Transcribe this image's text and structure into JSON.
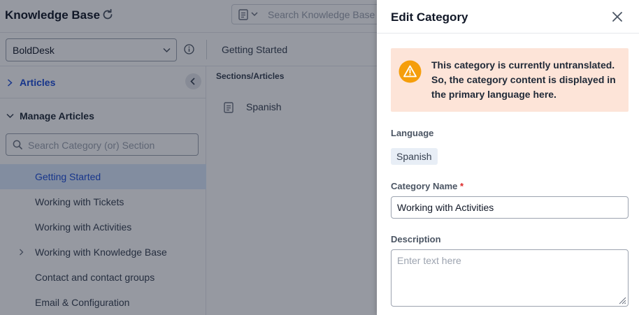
{
  "app": {
    "title": "Knowledge Base",
    "search_placeholder": "Search Knowledge Base",
    "brand_select": "BoldDesk",
    "breadcrumb": "Getting Started"
  },
  "sidebar": {
    "articles_label": "Articles",
    "manage_label": "Manage Articles",
    "search_placeholder": "Search Category (or) Section",
    "categories": [
      {
        "label": "Getting Started",
        "active": true
      },
      {
        "label": "Working with Tickets"
      },
      {
        "label": "Working with Activities"
      },
      {
        "label": "Working with Knowledge Base",
        "expandable": true
      },
      {
        "label": "Contact and contact groups"
      },
      {
        "label": "Email & Configuration"
      }
    ]
  },
  "main": {
    "column_header": "Sections/Articles",
    "items": [
      {
        "label": "Spanish"
      }
    ]
  },
  "dialog": {
    "title": "Edit Category",
    "warning": "This category is currently untranslated. So, the category content is displayed in the primary language here.",
    "language_label": "Language",
    "language_value": "Spanish",
    "name_label": "Category Name",
    "required_mark": "*",
    "name_value": "Working with Activities",
    "description_label": "Description",
    "description_placeholder": "Enter text here"
  },
  "icons": {
    "refresh": "refresh-icon",
    "document": "document-icon",
    "info": "info-icon",
    "search": "search-icon",
    "close": "close-icon",
    "warning": "warning-icon"
  },
  "colors": {
    "accent": "#1d4ed8",
    "active_bg": "#dbeafe",
    "warning_bg": "#fde4d8",
    "warning_icon": "#f59e0b",
    "required": "#dc2626"
  }
}
